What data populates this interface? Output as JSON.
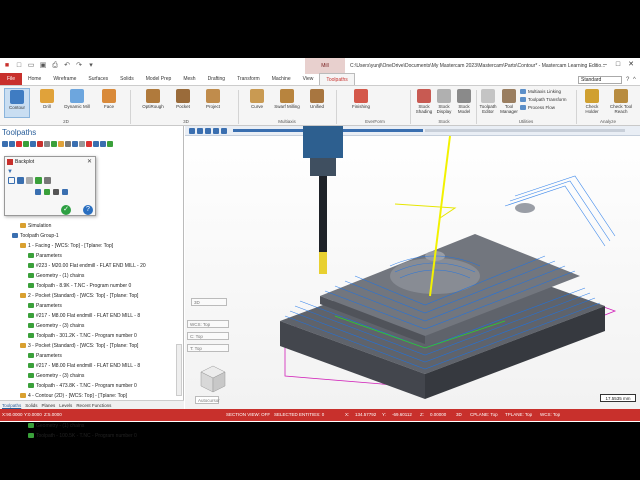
{
  "window": {
    "mill_context": "Mill",
    "title": "C:\\Users\\yunjl\\OneDrive\\Documents\\My Mastercam 2023\\Mastercam\\Parts\\Contour* - Mastercam Learning Editio..."
  },
  "tabs": [
    "File",
    "Home",
    "Wireframe",
    "Surfaces",
    "Solids",
    "Model Prep",
    "Mesh",
    "Drafting",
    "Transform",
    "Machine",
    "View",
    "Toolpaths"
  ],
  "active_tab": "Toolpaths",
  "standard_select": "Standard",
  "ribbon": {
    "buttons_2d": [
      "Contour",
      "Drill",
      "Dynamic Mill",
      "Face"
    ],
    "group_2d": "2D",
    "buttons_3d": [
      "OptiRough",
      "Pocket",
      "Project"
    ],
    "group_3d": "3D",
    "buttons_multiaxis": [
      "Curve",
      "Swarf Milling",
      "Unified"
    ],
    "group_multiaxis": "Multiaxis",
    "buttons_everform": [
      "Finishing"
    ],
    "group_everform": "EverForm",
    "buttons_stock": [
      "Stock Shading",
      "Stock Display",
      "Stock Model"
    ],
    "group_stock": "Stock",
    "buttons_utilities": [
      "Toolpath Editor",
      "Tool Manager"
    ],
    "utilities_small": [
      "Multiaxis Linking",
      "Toolpath Transform",
      "Process Flow"
    ],
    "group_utilities": "Utilities",
    "buttons_analyze": [
      "Check Holder",
      "Check Tool Reach"
    ],
    "group_analyze": "Analyze"
  },
  "panel": {
    "title": "Toolpaths",
    "tree": [
      {
        "text": "Simulation",
        "indent": 2
      },
      {
        "text": "Toolpath Group-1",
        "indent": 1
      },
      {
        "text": "1 - Facing - [WCS: Top] - [Tplane: Top]",
        "indent": 2
      },
      {
        "text": "Parameters",
        "indent": 3
      },
      {
        "text": "#223 - M20.00 Flat endmill - FLAT END MILL - 20",
        "indent": 3
      },
      {
        "text": "Geometry - (1) chains",
        "indent": 3
      },
      {
        "text": "Toolpath - 8.9K - T.NC - Program number 0",
        "indent": 3
      },
      {
        "text": "2 - Pocket (Standard) - [WCS: Top] - [Tplane: Top]",
        "indent": 2
      },
      {
        "text": "Parameters",
        "indent": 3
      },
      {
        "text": "#217 - M8.00 Flat endmill - FLAT END MILL - 8",
        "indent": 3
      },
      {
        "text": "Geometry - (3) chains",
        "indent": 3
      },
      {
        "text": "Toolpath - 301.2K - T.NC - Program number 0",
        "indent": 3
      },
      {
        "text": "3 - Pocket (Standard) - [WCS: Top] - [Tplane: Top]",
        "indent": 2
      },
      {
        "text": "Parameters",
        "indent": 3
      },
      {
        "text": "#217 - M8.00 Flat endmill - FLAT END MILL - 8",
        "indent": 3
      },
      {
        "text": "Geometry - (3) chains",
        "indent": 3
      },
      {
        "text": "Toolpath - 473.8K - T.NC - Program number 0",
        "indent": 3
      },
      {
        "text": "4 - Contour (2D) - [WCS: Top] - [Tplane: Top]",
        "indent": 2
      },
      {
        "text": "Parameters",
        "indent": 3
      },
      {
        "text": "#217 - M8.00 Flat endmill - FLAT END MILL - 8",
        "indent": 3
      },
      {
        "text": "Geometry - (1) chains",
        "indent": 3
      },
      {
        "text": "Toolpath - 100.5K - T.NC - Program number 0",
        "indent": 3
      }
    ]
  },
  "dialog": {
    "title": "Backplot"
  },
  "bottom_tabs": [
    "Toolpaths",
    "Solids",
    "Planes",
    "Levels",
    "Recent Functions"
  ],
  "viewport": {
    "fields": [
      "3D",
      "WCS: Top",
      "C: Top",
      "T: Top"
    ],
    "autocursor": "Autocursor",
    "scale": "17.5535 mm"
  },
  "status": {
    "x_top": "X:90.0000",
    "y_top": "Y:0.0000",
    "z_top": "Z:5.0000",
    "section_view": "SECTION VIEW: OFF",
    "selected": "SELECTED ENTITIES: 0",
    "x_label": "X:",
    "x_val": "134.57792",
    "y_label": "Y:",
    "y_val": "-69.60112",
    "z_label": "Z:",
    "z_val": "0.00000",
    "mode": "3D",
    "cplane": "CPLANE: Top",
    "tplane": "TPLANE: Top",
    "wcs": "WCS: Top"
  }
}
